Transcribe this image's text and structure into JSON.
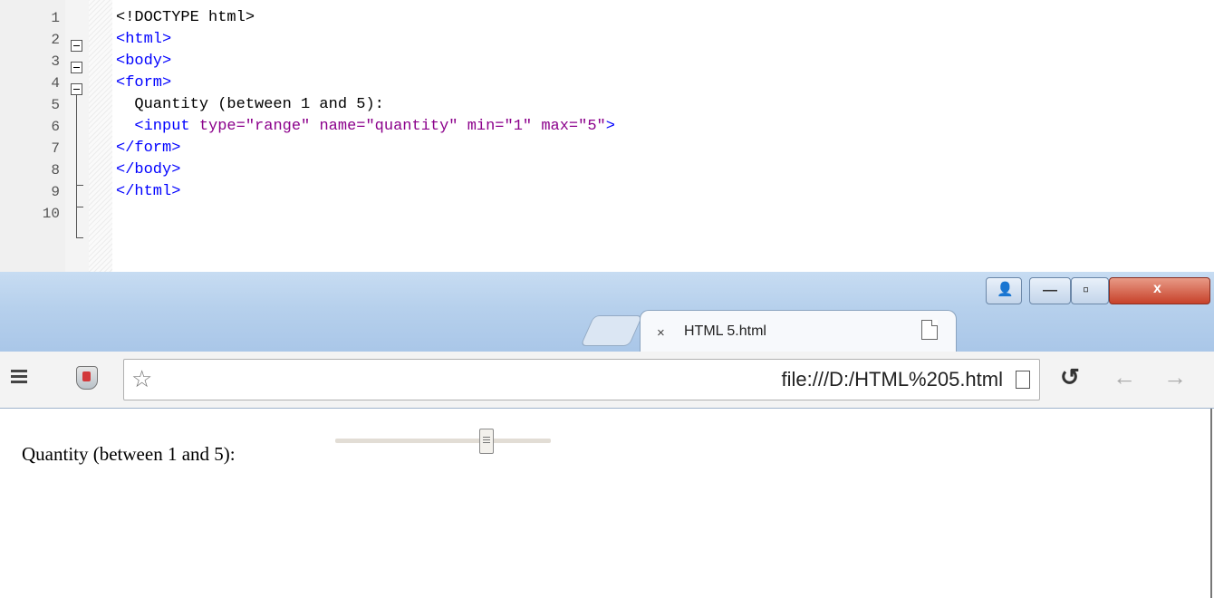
{
  "editor": {
    "lines": [
      {
        "num": "1",
        "parts": [
          {
            "t": "<!DOCTYPE html>",
            "c": "plain"
          }
        ]
      },
      {
        "num": "2",
        "parts": [
          {
            "t": "<html>",
            "c": "tag"
          }
        ]
      },
      {
        "num": "3",
        "parts": [
          {
            "t": "<body>",
            "c": "tag"
          }
        ]
      },
      {
        "num": "4",
        "parts": [
          {
            "t": "<form>",
            "c": "tag"
          }
        ]
      },
      {
        "num": "5",
        "parts": [
          {
            "t": "  Quantity (between 1 and 5):",
            "c": "plain"
          }
        ]
      },
      {
        "num": "6",
        "parts": [
          {
            "t": "  <input ",
            "c": "tag"
          },
          {
            "t": "type=",
            "c": "attr"
          },
          {
            "t": "\"range\" ",
            "c": "val"
          },
          {
            "t": "name=",
            "c": "attr"
          },
          {
            "t": "\"quantity\" ",
            "c": "val"
          },
          {
            "t": "min=",
            "c": "attr"
          },
          {
            "t": "\"1\" ",
            "c": "val"
          },
          {
            "t": "max=",
            "c": "attr"
          },
          {
            "t": "\"5\"",
            "c": "val"
          },
          {
            "t": ">",
            "c": "tag"
          }
        ]
      },
      {
        "num": "7",
        "parts": [
          {
            "t": "</form>",
            "c": "tag"
          }
        ]
      },
      {
        "num": "8",
        "parts": [
          {
            "t": "</body>",
            "c": "tag"
          }
        ]
      },
      {
        "num": "9",
        "parts": [
          {
            "t": "</html>",
            "c": "tag"
          }
        ]
      },
      {
        "num": "10",
        "parts": []
      }
    ]
  },
  "browser": {
    "tab": {
      "title": "HTML 5.html",
      "close_glyph": "×"
    },
    "address": {
      "url": "file:///D:/HTML%205.html",
      "star_glyph": "☆"
    },
    "nav": {
      "reload_glyph": "↺",
      "back_glyph": "←",
      "forward_glyph": "→"
    },
    "window_buttons": {
      "minimize_glyph": "—",
      "maximize_glyph": "▫",
      "close_glyph": "x",
      "user_glyph": "👤"
    },
    "page": {
      "label": "Quantity (between 1 and 5):",
      "slider": {
        "min": 1,
        "max": 5,
        "value": 4
      }
    }
  },
  "colors": {
    "tag": "#0000ff",
    "attr": "#8b008b",
    "titlebar": "#b6d0ec"
  }
}
